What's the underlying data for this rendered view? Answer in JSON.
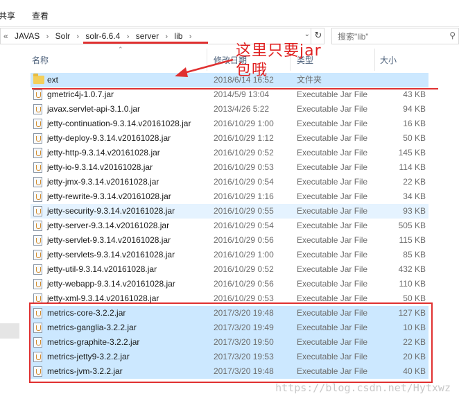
{
  "ribbon": {
    "tabs": [
      "共享",
      "查看"
    ]
  },
  "address": {
    "prefix": "«",
    "crumbs": [
      "JAVAS",
      "Solr",
      "solr-6.6.4",
      "server",
      "lib"
    ]
  },
  "search": {
    "placeholder": "搜索\"lib\""
  },
  "columns": {
    "name": "名称",
    "date": "修改日期",
    "type": "类型",
    "size": "大小"
  },
  "files": [
    {
      "name": "ext",
      "date": "2018/6/14 16:52",
      "type": "文件夹",
      "size": "",
      "kind": "folder"
    },
    {
      "name": "gmetric4j-1.0.7.jar",
      "date": "2014/5/9 13:04",
      "type": "Executable Jar File",
      "size": "43 KB",
      "kind": "jar"
    },
    {
      "name": "javax.servlet-api-3.1.0.jar",
      "date": "2013/4/26 5:22",
      "type": "Executable Jar File",
      "size": "94 KB",
      "kind": "jar"
    },
    {
      "name": "jetty-continuation-9.3.14.v20161028.jar",
      "date": "2016/10/29 1:00",
      "type": "Executable Jar File",
      "size": "16 KB",
      "kind": "jar"
    },
    {
      "name": "jetty-deploy-9.3.14.v20161028.jar",
      "date": "2016/10/29 1:12",
      "type": "Executable Jar File",
      "size": "50 KB",
      "kind": "jar"
    },
    {
      "name": "jetty-http-9.3.14.v20161028.jar",
      "date": "2016/10/29 0:52",
      "type": "Executable Jar File",
      "size": "145 KB",
      "kind": "jar"
    },
    {
      "name": "jetty-io-9.3.14.v20161028.jar",
      "date": "2016/10/29 0:53",
      "type": "Executable Jar File",
      "size": "114 KB",
      "kind": "jar"
    },
    {
      "name": "jetty-jmx-9.3.14.v20161028.jar",
      "date": "2016/10/29 0:54",
      "type": "Executable Jar File",
      "size": "22 KB",
      "kind": "jar"
    },
    {
      "name": "jetty-rewrite-9.3.14.v20161028.jar",
      "date": "2016/10/29 1:16",
      "type": "Executable Jar File",
      "size": "34 KB",
      "kind": "jar"
    },
    {
      "name": "jetty-security-9.3.14.v20161028.jar",
      "date": "2016/10/29 0:55",
      "type": "Executable Jar File",
      "size": "93 KB",
      "kind": "jar"
    },
    {
      "name": "jetty-server-9.3.14.v20161028.jar",
      "date": "2016/10/29 0:54",
      "type": "Executable Jar File",
      "size": "505 KB",
      "kind": "jar"
    },
    {
      "name": "jetty-servlet-9.3.14.v20161028.jar",
      "date": "2016/10/29 0:56",
      "type": "Executable Jar File",
      "size": "115 KB",
      "kind": "jar"
    },
    {
      "name": "jetty-servlets-9.3.14.v20161028.jar",
      "date": "2016/10/29 1:00",
      "type": "Executable Jar File",
      "size": "85 KB",
      "kind": "jar"
    },
    {
      "name": "jetty-util-9.3.14.v20161028.jar",
      "date": "2016/10/29 0:52",
      "type": "Executable Jar File",
      "size": "432 KB",
      "kind": "jar"
    },
    {
      "name": "jetty-webapp-9.3.14.v20161028.jar",
      "date": "2016/10/29 0:56",
      "type": "Executable Jar File",
      "size": "110 KB",
      "kind": "jar"
    },
    {
      "name": "jetty-xml-9.3.14.v20161028.jar",
      "date": "2016/10/29 0:53",
      "type": "Executable Jar File",
      "size": "50 KB",
      "kind": "jar"
    },
    {
      "name": "metrics-core-3.2.2.jar",
      "date": "2017/3/20 19:48",
      "type": "Executable Jar File",
      "size": "127 KB",
      "kind": "jar"
    },
    {
      "name": "metrics-ganglia-3.2.2.jar",
      "date": "2017/3/20 19:49",
      "type": "Executable Jar File",
      "size": "10 KB",
      "kind": "jar"
    },
    {
      "name": "metrics-graphite-3.2.2.jar",
      "date": "2017/3/20 19:50",
      "type": "Executable Jar File",
      "size": "22 KB",
      "kind": "jar"
    },
    {
      "name": "metrics-jetty9-3.2.2.jar",
      "date": "2017/3/20 19:53",
      "type": "Executable Jar File",
      "size": "20 KB",
      "kind": "jar"
    },
    {
      "name": "metrics-jvm-3.2.2.jar",
      "date": "2017/3/20 19:48",
      "type": "Executable Jar File",
      "size": "40 KB",
      "kind": "jar"
    }
  ],
  "annotation": {
    "line1": "这里只要jar",
    "line2": "包哦"
  },
  "watermark": "https://blog.csdn.net/Hytxwz",
  "colors": {
    "selection": "#cce8ff",
    "hover": "#e5f3ff",
    "annotation": "#e03030",
    "header_text": "#4c607a"
  }
}
